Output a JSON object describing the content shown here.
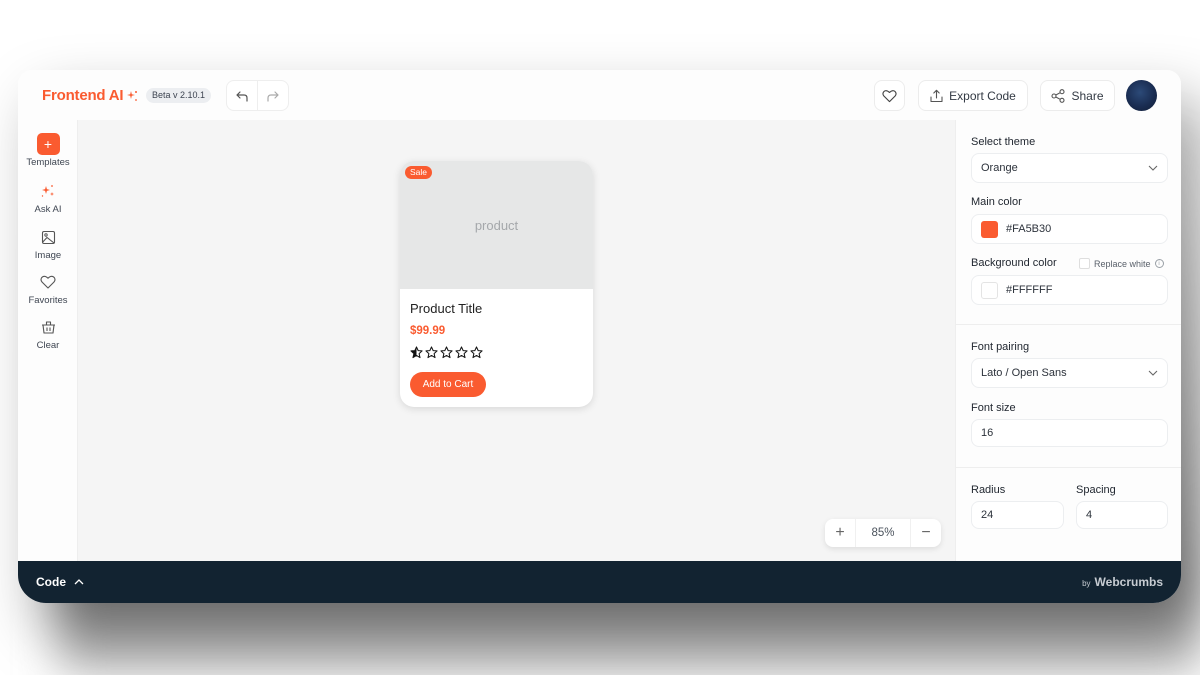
{
  "header": {
    "app_name": "Frontend AI",
    "version_badge": "Beta v 2.10.1",
    "undo_icon": "undo-arrow-icon",
    "redo_icon": "redo-arrow-icon",
    "favorite_icon": "heart-icon",
    "export_label": "Export Code",
    "share_label": "Share",
    "avatar_icon": "user-avatar"
  },
  "sidebar": {
    "items": [
      {
        "label": "Templates",
        "icon": "plus-icon"
      },
      {
        "label": "Ask AI",
        "icon": "sparkles-icon"
      },
      {
        "label": "Image",
        "icon": "image-icon"
      },
      {
        "label": "Favorites",
        "icon": "heart-icon"
      },
      {
        "label": "Clear",
        "icon": "trash-icon"
      }
    ]
  },
  "canvas": {
    "product_card": {
      "badge": "Sale",
      "image_placeholder": "product",
      "title": "Product Title",
      "price": "$99.99",
      "rating": 0.5,
      "rating_max": 5,
      "button_label": "Add to Cart"
    },
    "zoom": {
      "plus": "+",
      "value": "85%",
      "minus": "−"
    }
  },
  "panel": {
    "theme_label": "Select theme",
    "theme_value": "Orange",
    "main_color_label": "Main color",
    "main_color_value": "#FA5B30",
    "bg_color_label": "Background color",
    "replace_white_label": "Replace white",
    "replace_white_checked": false,
    "bg_color_value": "#FFFFFF",
    "font_pairing_label": "Font pairing",
    "font_pairing_value": "Lato / Open Sans",
    "font_size_label": "Font size",
    "font_size_value": "16",
    "radius_label": "Radius",
    "radius_value": "24",
    "spacing_label": "Spacing",
    "spacing_value": "4"
  },
  "codebar": {
    "label": "Code",
    "brand_by": "by",
    "brand_name": "Webcrumbs"
  },
  "colors": {
    "accent": "#FA5B30",
    "codebar_bg": "#122331",
    "canvas_bg": "#F5F5F5"
  }
}
